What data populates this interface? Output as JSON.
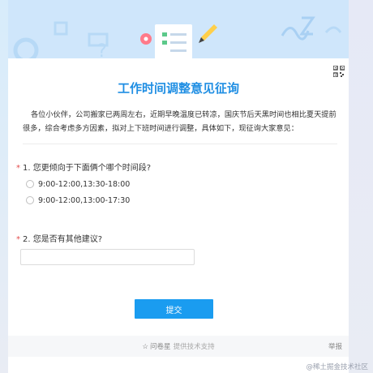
{
  "survey": {
    "title": "工作时间调整意见征询",
    "intro": "各位小伙伴，公司搬家已两周左右，近期早晚温度已转凉，国庆节后天黑时间也相比夏天提前很多，综合考虑多方因素，拟对上下班时间进行调整，具体如下，现征询大家意见："
  },
  "questions": [
    {
      "required_mark": "*",
      "label": "1. 您更倾向于下面俩个哪个时间段?",
      "options": [
        "9:00-12:00,13:30-18:00",
        "9:00-12:00,13:00-17:30"
      ]
    },
    {
      "required_mark": "*",
      "label": "2. 您是否有其他建议?",
      "value": ""
    }
  ],
  "submit_label": "提交",
  "footer": {
    "brand": "问卷星",
    "support": "提供技术支持",
    "report": "举报"
  },
  "watermark": "@稀土掘金技术社区",
  "colors": {
    "accent": "#1a9cf0",
    "title": "#1f8ee3",
    "required": "#e34d4d",
    "banner": "#cfe6fb"
  }
}
